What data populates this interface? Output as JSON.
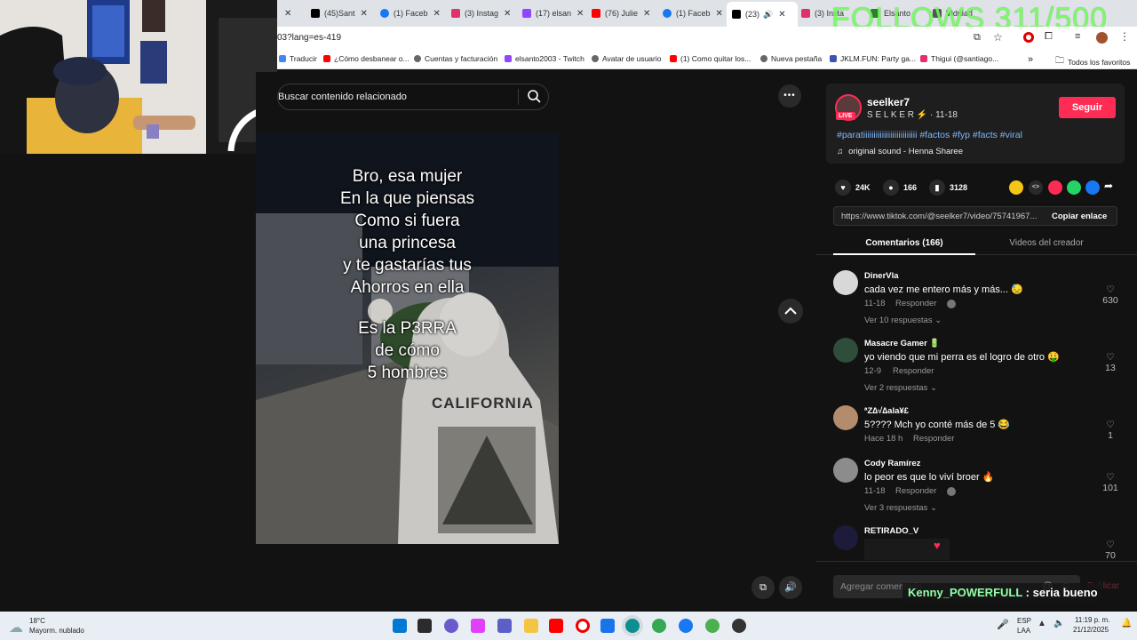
{
  "overlay": {
    "follows_text": "FOLLOWS 311/500",
    "chat_user": "Kenny_POWERFULL",
    "chat_message": " : seria bueno"
  },
  "browser": {
    "tabs": [
      {
        "label": "",
        "color": "#888"
      },
      {
        "label": "(45)Sant",
        "color": "#000"
      },
      {
        "label": "(1) Faceb",
        "color": "#1877f2"
      },
      {
        "label": "(3) Instag",
        "color": "#e1306c"
      },
      {
        "label": "(17) elsan",
        "color": "#9146ff"
      },
      {
        "label": "(76) Julie",
        "color": "#ff0000"
      },
      {
        "label": "(1) Faceb",
        "color": "#1877f2"
      },
      {
        "label": "(23)",
        "color": "#000"
      },
      {
        "label": "(3) Insta",
        "color": "#e1306c"
      },
      {
        "label": "Elsanto",
        "color": "#2e7d32"
      },
      {
        "label": "Vidriiad",
        "color": "#555"
      }
    ],
    "url": "03?lang=es-419",
    "bookmarks": [
      {
        "label": "Traducir",
        "color": "#4285f4"
      },
      {
        "label": "¿Cómo desbanear o...",
        "color": "#ff0000"
      },
      {
        "label": "Cuentas y facturación",
        "color": "#666"
      },
      {
        "label": "elsanto2003 - Twitch",
        "color": "#9146ff"
      },
      {
        "label": "Avatar de usuario",
        "color": "#666"
      },
      {
        "label": "(1) Como quitar los...",
        "color": "#ff0000"
      },
      {
        "label": "Nueva pestaña",
        "color": "#666"
      },
      {
        "label": "JKLM.FUN: Party ga...",
        "color": "#3f51b5"
      },
      {
        "label": "Thigui (@santiago...",
        "color": "#e1306c"
      }
    ],
    "bookmarks_more": "»",
    "all_favorites": "Todos los favoritos"
  },
  "tiktok": {
    "search_placeholder": "Buscar contenido relacionado",
    "more_icon": "•••",
    "caption_top": [
      "Bro, esa mujer",
      "En la que piensas",
      "Como si fuera",
      "una princesa",
      "y te gastarías  tus",
      "Ahorros en ella"
    ],
    "caption_bottom": [
      "Es la P3RRA",
      "de cómo",
      "5 hombres"
    ],
    "hoodie_text": "CALIFORNIA",
    "creator": {
      "username": "seelker7",
      "display": "S E L K E R",
      "date": " · 11-18",
      "live": "LIVE",
      "follow": "Seguir"
    },
    "hashtags": "#paratiiiiiiiiiiiiiiiiiiiiiiiiii #factos #fyp #facts #viral",
    "sound": "original sound - Henna Sharee",
    "stats": {
      "likes": "24K",
      "comments": "166",
      "saves": "3128"
    },
    "share_url": "https://www.tiktok.com/@seelker7/video/75741967...",
    "copy_link": "Copiar enlace",
    "tabs": {
      "comments": "Comentarios (166)",
      "creator_videos": "Videos del creador"
    },
    "comments": [
      {
        "name": "DinerVla",
        "text": "cada vez me entero más y más... 😓",
        "date": "11-18",
        "reply": "Responder",
        "more": "Ver 10 respuestas",
        "likes": "630",
        "avatar": "#d8d8d8"
      },
      {
        "name": "Masacre Gamer 🔋",
        "text": "yo viendo que mi perra es el logro de otro 🤑",
        "date": "12-9",
        "reply": "Responder",
        "more": "Ver 2 respuestas",
        "likes": "13",
        "avatar": "#2e4d3a"
      },
      {
        "name": "ªZ∆√∆ala¥£",
        "text": "5???? Mch yo conté más de 5 😂",
        "date": "Hace 18 h",
        "reply": "Responder",
        "more": "",
        "likes": "1",
        "avatar": "#b38b6d"
      },
      {
        "name": "Cody Ramírez",
        "text": "lo peor es que lo viví broer 🔥",
        "date": "11-18",
        "reply": "Responder",
        "more": "Ver 3 respuestas",
        "likes": "101",
        "avatar": "#8c8c8c"
      },
      {
        "name": "RETIRADO_V",
        "text": "",
        "date": "",
        "reply": "",
        "more": "",
        "likes": "70",
        "avatar": "#1c1c3a"
      }
    ],
    "add_comment": "Agregar comentario...",
    "publish": "Publicar"
  },
  "taskbar": {
    "weather_temp": "18°C",
    "weather_desc": "Mayorm. nublado",
    "lang1": "ESP",
    "lang2": "LAA",
    "time": "11:19 p. m.",
    "date": "21/12/2025"
  }
}
